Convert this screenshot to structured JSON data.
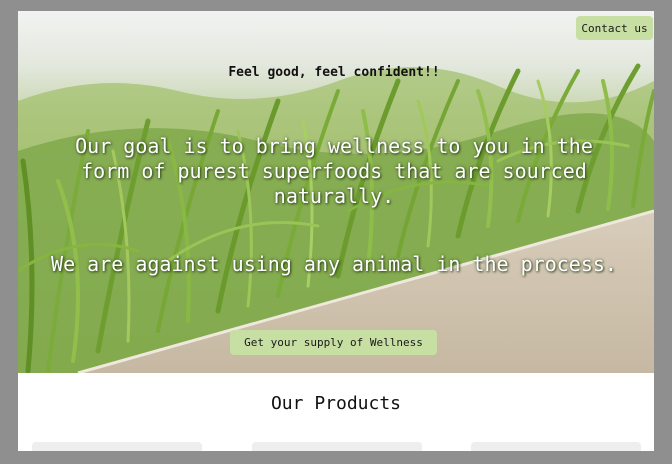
{
  "header": {
    "contact_label": "Contact us"
  },
  "hero": {
    "tagline": "Feel good, feel confident!!",
    "goal_text": "Our goal is to bring wellness to you in the form of purest superfoods that are sourced naturally.",
    "against_text": "We are against using any animal in the process.",
    "cta_label": "Get your supply of Wellness",
    "image_semantic": "grass-hero-image"
  },
  "products": {
    "title": "Our Products",
    "cards": [
      {},
      {},
      {}
    ]
  },
  "colors": {
    "button_bg": "#c8dfa3",
    "frame_bg": "#8f8f8f",
    "page_bg": "#ffffff"
  }
}
